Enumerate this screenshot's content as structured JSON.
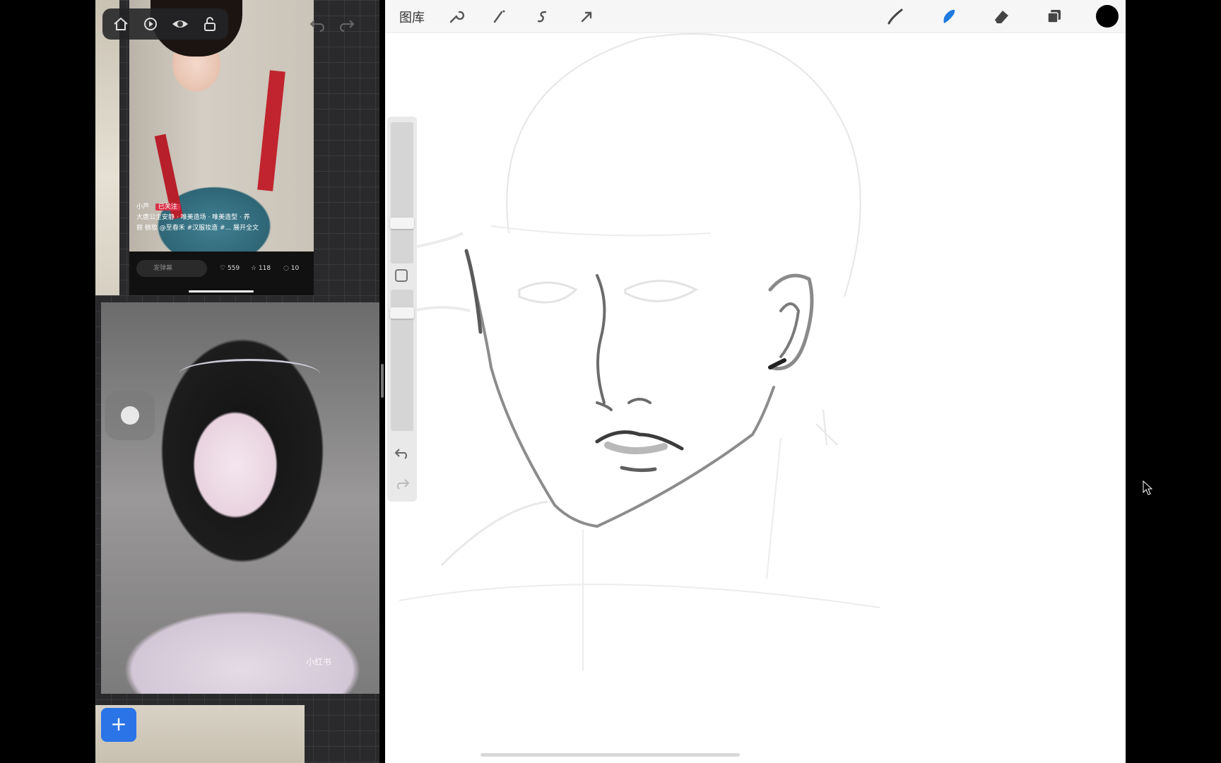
{
  "app": "Procreate",
  "topbar": {
    "gallery_label": "图库",
    "tools_left": [
      "wrench-icon",
      "magic-wand-icon",
      "selection-icon",
      "transform-arrow-icon"
    ],
    "tools_right": [
      "brush-icon",
      "smudge-icon",
      "eraser-icon",
      "layers-icon",
      "color-swatch"
    ],
    "active_tool": "smudge-icon",
    "accent_color": "#1f7ae0",
    "current_color": "#000000"
  },
  "reference_panel": {
    "toolbar_icons": [
      "home-icon",
      "play-icon",
      "eye-icon",
      "unlock-icon"
    ],
    "undo_icons": [
      "undo-icon",
      "redo-icon"
    ],
    "post": {
      "author": "小芦",
      "follow_label": "已关注",
      "caption_line1": "大唐公主安静 · 唯美造场 · 唯美造型 · 养",
      "caption_line2": "丽 侧妆 @至春禾 #汉服妆造 #... 展开全文",
      "comment_placeholder": "发弹幕",
      "likes": "559",
      "favorites": "118",
      "comments": "10"
    },
    "watermark": "小红书",
    "add_button_label": "+",
    "float_button": "assistive-touch"
  },
  "sidebar": {
    "brush_size_slider": 0.8,
    "opacity_slider": 0.9,
    "buttons": [
      "modify-square-icon",
      "undo-icon",
      "redo-icon"
    ]
  }
}
